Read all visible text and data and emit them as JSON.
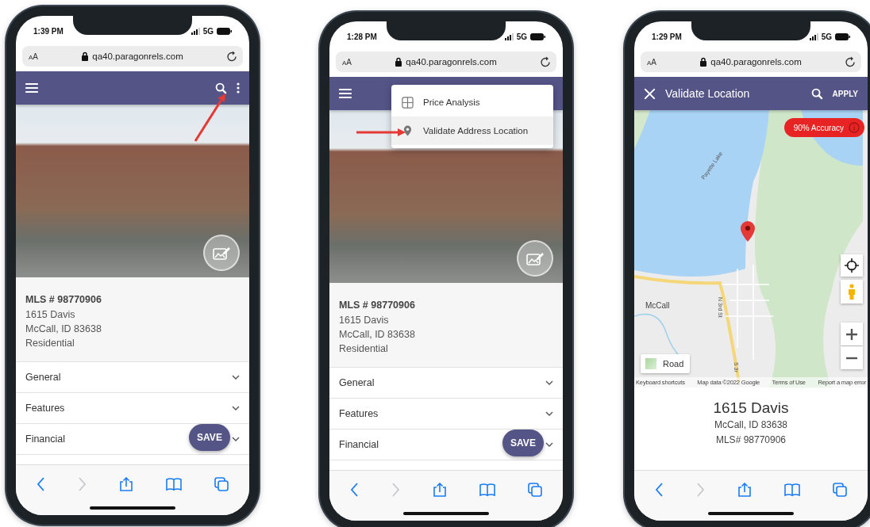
{
  "phones": [
    {
      "kind": "listing",
      "status": {
        "time": "1:39 PM",
        "network": "5G"
      },
      "address_bar": {
        "text_size": "AA",
        "url": "qa40.paragonrels.com"
      },
      "app_bar": {
        "kind": "main",
        "search": true,
        "more": true
      },
      "callout_arrow": true,
      "listing": {
        "mls": "MLS # 98770906",
        "street": "1615 Davis",
        "city": "McCall, ID 83638",
        "type": "Residential"
      },
      "sections": [
        {
          "label": "General",
          "expanded": false
        },
        {
          "label": "Features",
          "expanded": false
        },
        {
          "label": "Financial",
          "expanded": false
        }
      ],
      "save_button": "SAVE",
      "toolbar": {
        "forward_disabled": true
      }
    },
    {
      "kind": "listing",
      "status": {
        "time": "1:28 PM",
        "network": "5G"
      },
      "address_bar": {
        "text_size": "AA",
        "url": "qa40.paragonrels.com"
      },
      "app_bar": {
        "kind": "main",
        "search": false,
        "more": false
      },
      "callout_arrow": true,
      "menu": [
        {
          "label": "Price Analysis",
          "kind": "grid",
          "selected": false
        },
        {
          "label": "Validate Address Location",
          "kind": "pin",
          "selected": true
        }
      ],
      "listing": {
        "mls": "MLS # 98770906",
        "street": "1615 Davis",
        "city": "McCall, ID 83638",
        "type": "Residential"
      },
      "sections": [
        {
          "label": "General",
          "expanded": false
        },
        {
          "label": "Features",
          "expanded": false
        },
        {
          "label": "Financial",
          "expanded": false
        }
      ],
      "save_button": "SAVE",
      "toolbar": {
        "forward_disabled": true
      }
    },
    {
      "kind": "map",
      "status": {
        "time": "1:29 PM",
        "network": "5G"
      },
      "address_bar": {
        "text_size": "AA",
        "url": "qa40.paragonrels.com"
      },
      "app_bar": {
        "kind": "close",
        "title": "Validate Location",
        "search": true,
        "action": "APPLY"
      },
      "map": {
        "accuracy": "90% Accuracy",
        "labels": [
          "Payette Lake",
          "McCall",
          "N 3rd St",
          "S 3r"
        ],
        "map_type": "Road",
        "attribution": [
          "Keyboard shortcuts",
          "Map data ©2022 Google",
          "Terms of Use",
          "Report a map error"
        ]
      },
      "card": {
        "street": "1615 Davis",
        "city": "McCall, ID 83638",
        "mls": "MLS# 98770906"
      },
      "toolbar": {
        "forward_disabled": true
      }
    }
  ]
}
